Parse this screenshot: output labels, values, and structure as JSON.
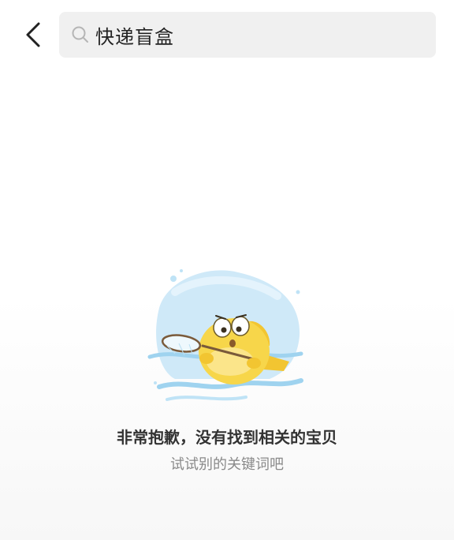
{
  "header": {
    "back_icon": "chevron-left-icon",
    "search": {
      "icon": "search-icon",
      "query": "快递盲盒"
    }
  },
  "empty_state": {
    "illustration": "fish-with-net-illustration",
    "title": "非常抱歉，没有找到相关的宝贝",
    "subtitle": "试试别的关键词吧"
  },
  "colors": {
    "search_bg": "#f0f0f0",
    "title_text": "#333333",
    "subtitle_text": "#8a8a8a",
    "fish_yellow": "#f7d64a",
    "water_blue": "#bfe3f6"
  }
}
